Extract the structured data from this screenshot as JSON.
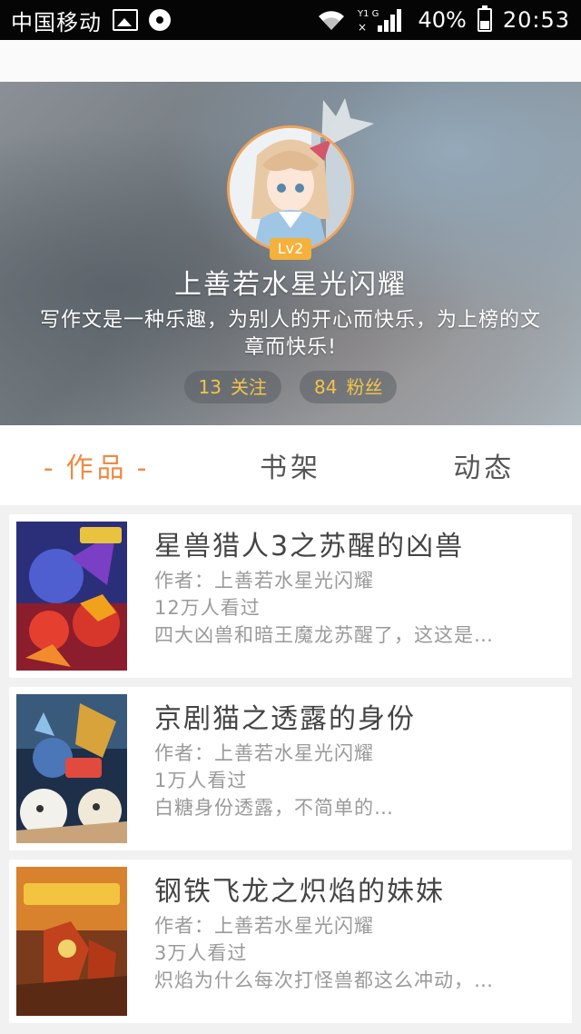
{
  "status_bar": {
    "carrier": "中国移动",
    "battery": "40%",
    "time": "20:53"
  },
  "colors": {
    "accent": "#ef8a43",
    "stat_text": "#f3c44a",
    "level_badge": "#f4b13c"
  },
  "profile": {
    "level": "Lv2",
    "username": "上善若水星光闪耀",
    "bio": "写作文是一种乐趣，为别人的开心而快乐，为上榜的文章而快乐!",
    "following_count": "13",
    "following_label": "关注",
    "followers_count": "84",
    "followers_label": "粉丝"
  },
  "tabs": [
    {
      "label": "作品",
      "active": true,
      "decor": "-"
    },
    {
      "label": "书架",
      "active": false
    },
    {
      "label": "动态",
      "active": false
    }
  ],
  "works": [
    {
      "title": "星兽猎人3之苏醒的凶兽",
      "author": "作者：上善若水星光闪耀",
      "views": "12万人看过",
      "summary": "四大凶兽和暗王魔龙苏醒了，这这是…"
    },
    {
      "title": "京剧猫之透露的身份",
      "author": "作者：上善若水星光闪耀",
      "views": "1万人看过",
      "summary": "白糖身份透露，不简单的…"
    },
    {
      "title": "钢铁飞龙之炽焰的妹妹",
      "author": "作者：上善若水星光闪耀",
      "views": "3万人看过",
      "summary": "炽焰为什么每次打怪兽都这么冲动，…"
    }
  ]
}
